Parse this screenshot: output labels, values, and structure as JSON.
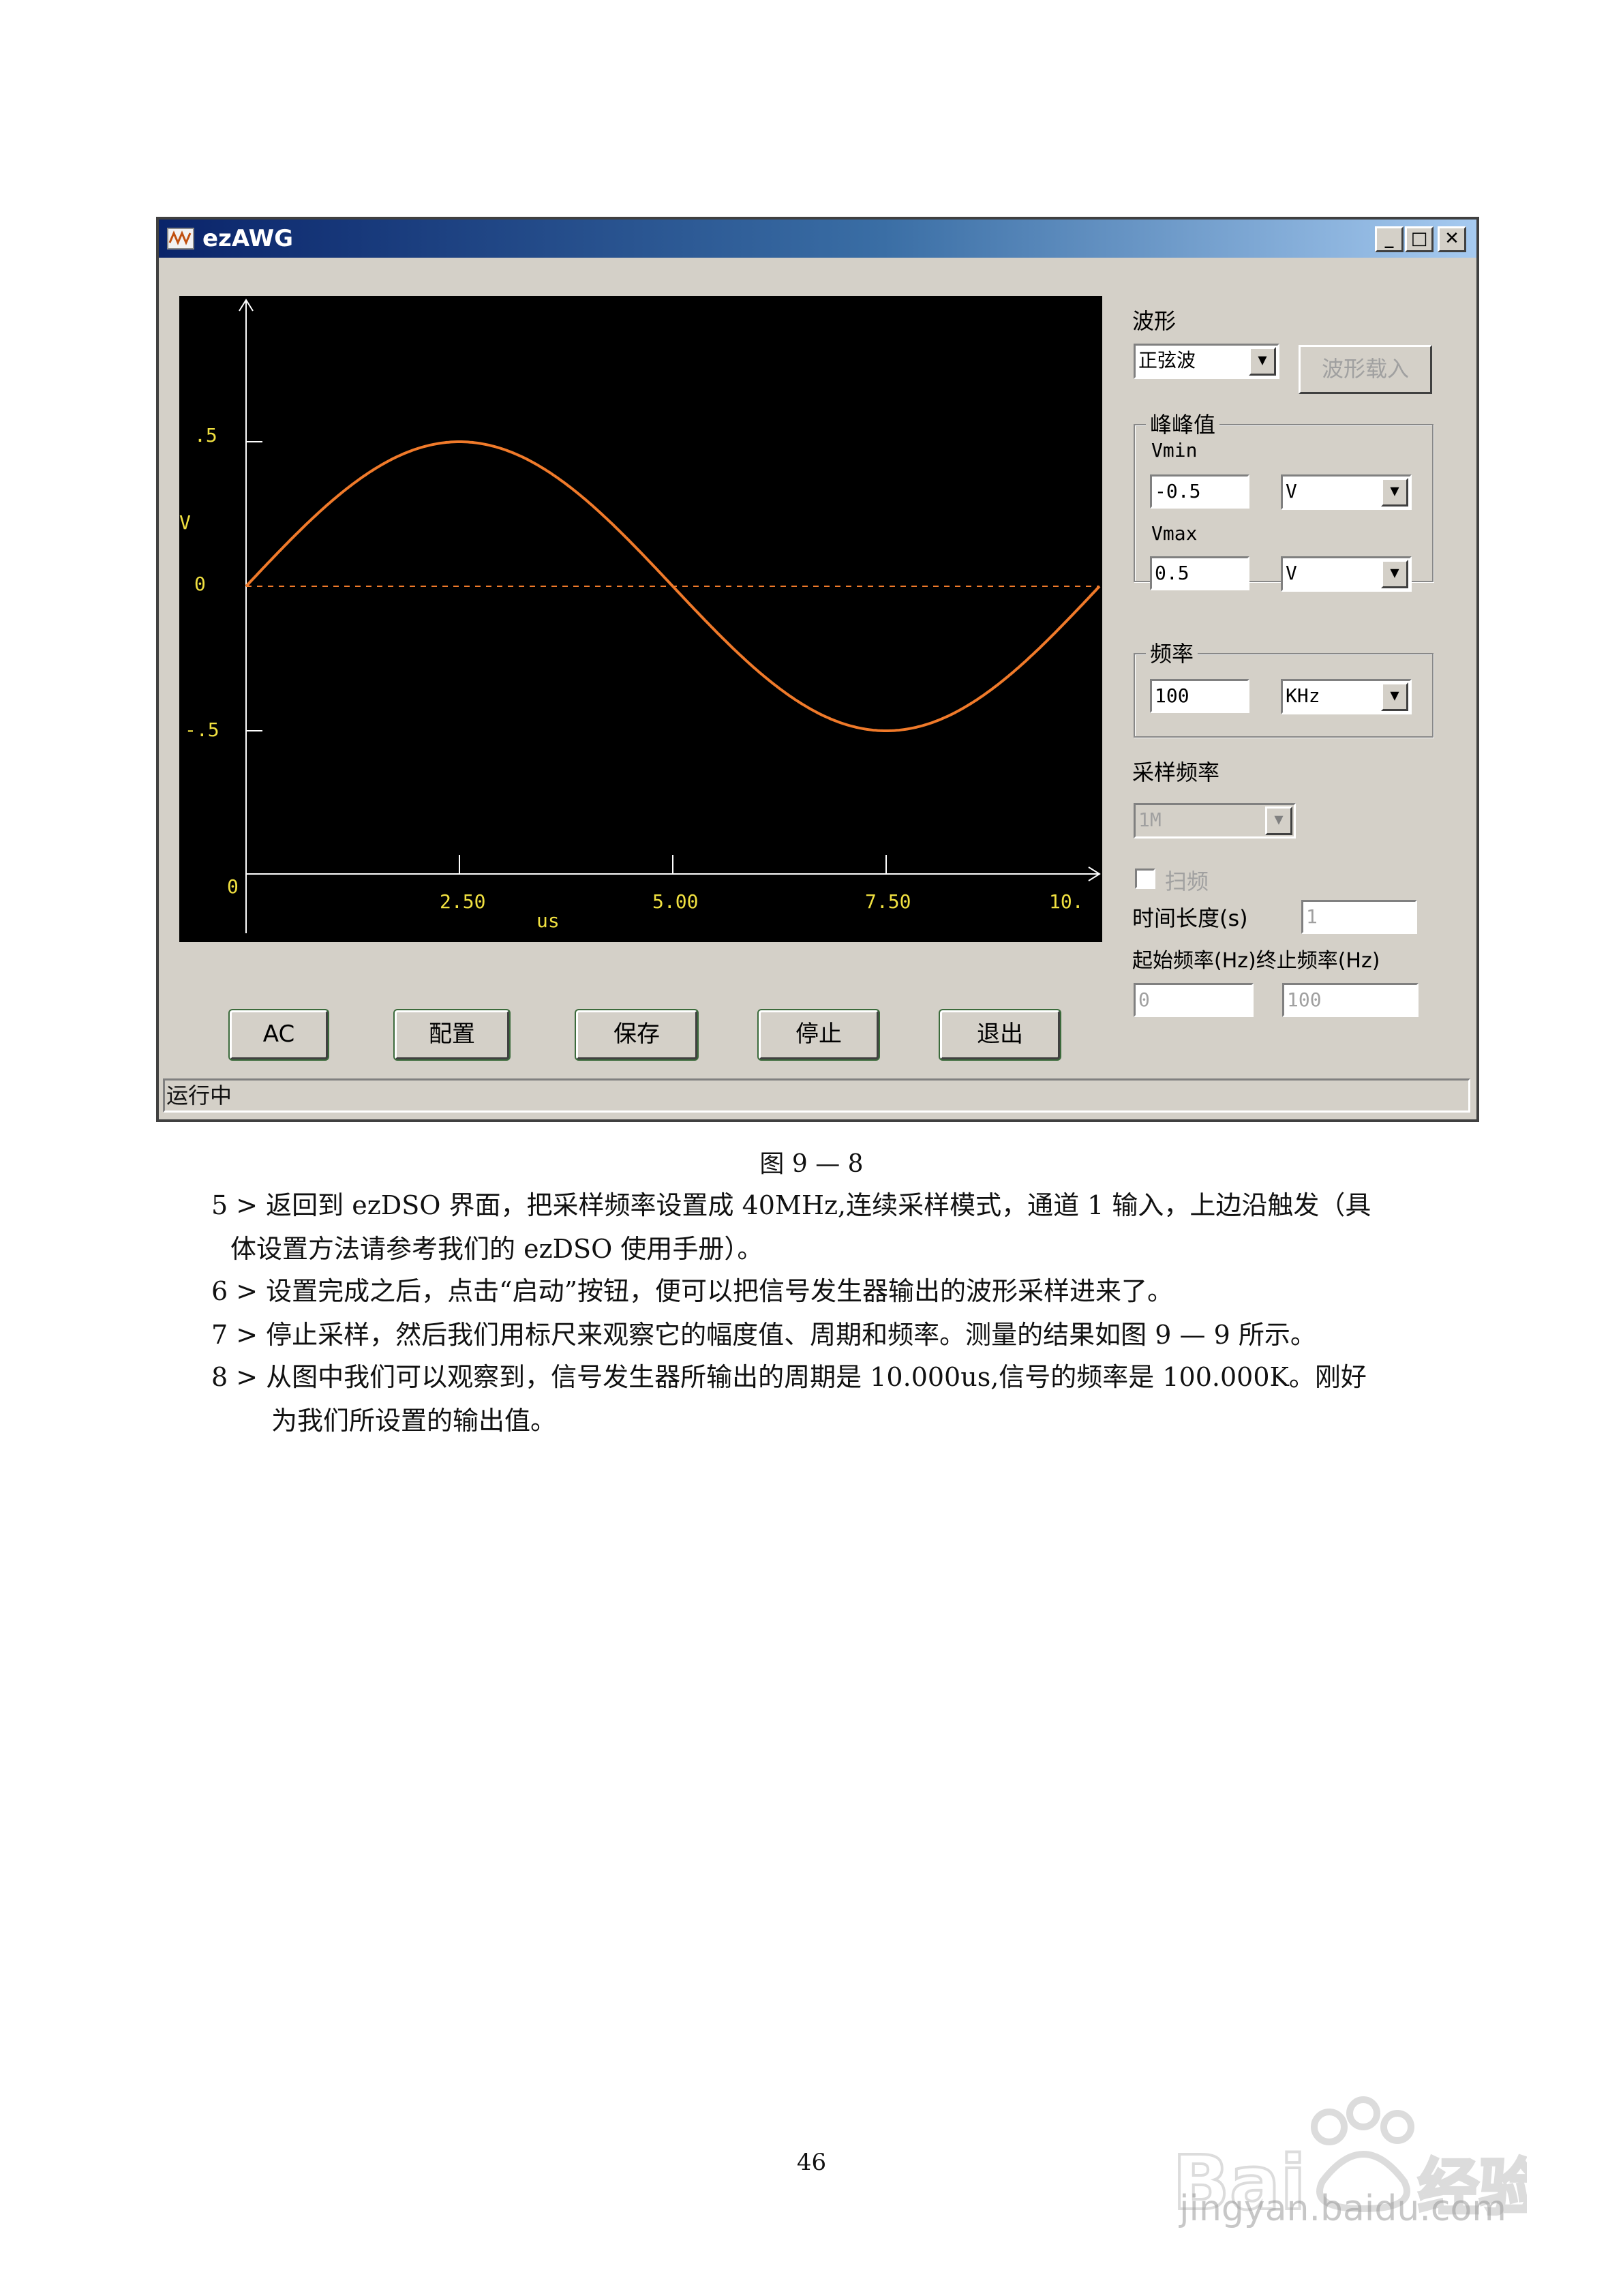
{
  "window": {
    "title": "ezAWG",
    "minimize": "_",
    "maximize": "□",
    "close": "✕"
  },
  "plot": {
    "y_label": "V",
    "x_unit": "us",
    "y_ticks": [
      ".5",
      "0",
      "-.5"
    ],
    "x_ticks": [
      "0",
      "2.50",
      "5.00",
      "7.50",
      "10."
    ]
  },
  "chart_data": {
    "type": "line",
    "series": [
      {
        "type": "sine",
        "amplitude": 0.5,
        "offset": 0,
        "period": 10.0
      }
    ],
    "reference_line": 0,
    "xlim": [
      0,
      10
    ],
    "ylim": [
      -0.75,
      0.85
    ],
    "xlabel": "us",
    "ylabel": "V",
    "colors": {
      "waveform": "#f07a2a",
      "zero_line": "#f07a2a",
      "axes": "#ffffff",
      "tick_labels": "#f0e040",
      "background": "#000000"
    }
  },
  "controls": {
    "waveform_label": "波形",
    "waveform_value": "正弦波",
    "load_button": "波形载入",
    "pp_group": "峰峰值",
    "vmin_label": "Vmin",
    "vmin_value": "-0.5",
    "vmin_unit": "V",
    "vmax_label": "Vmax",
    "vmax_value": "0.5",
    "vmax_unit": "V",
    "freq_group": "频率",
    "freq_value": "100",
    "freq_unit": "KHz",
    "sample_label": "采样频率",
    "sample_value": "1M",
    "sweep_label": "扫频",
    "duration_label": "时间长度(s)",
    "duration_value": "1",
    "start_stop_label": "起始频率(Hz)终止频率(Hz)",
    "start_freq": "0",
    "stop_freq": "100"
  },
  "buttons": {
    "ac": "AC",
    "config": "配置",
    "save": "保存",
    "stop": "停止",
    "exit": "退出"
  },
  "status": "运行中",
  "doc": {
    "caption": "图 9 — 8",
    "p5_line1": "5 > 返回到 ezDSO 界面，把采样频率设置成 40MHz,连续采样模式，通道 1 输入，上边沿触发（具",
    "p5_line2": "体设置方法请参考我们的 ezDSO 使用手册）。",
    "p6": "6 > 设置完成之后，点击“启动”按钮，便可以把信号发生器输出的波形采样进来了。",
    "p7": "7 > 停止采样，然后我们用标尺来观察它的幅度值、周期和频率。测量的结果如图 9 — 9 所示。",
    "p8_line1": "8 > 从图中我们可以观察到，信号发生器所输出的周期是 10.000us,信号的频率是 100.000K。刚好",
    "p8_line2": "为我们所设置的输出值。",
    "page_number": "46"
  },
  "watermark": {
    "logo": "Baidu 经验",
    "url": "jingyan.baidu.com"
  }
}
